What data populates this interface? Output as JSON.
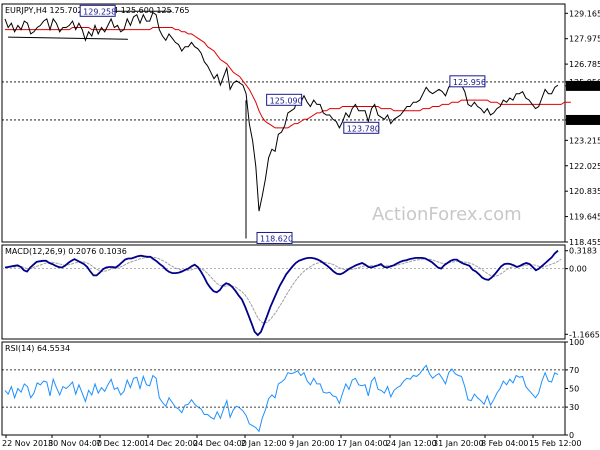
{
  "chart_data": [
    {
      "panel": "price",
      "type": "line",
      "header": "EURJPY,H4  125.702 125.904 125.600 125.765",
      "y_ticks": [
        "129.165",
        "127.975",
        "126.785",
        "125.950",
        "125.765",
        "124.170",
        "123.215",
        "122.025",
        "120.835",
        "119.645",
        "118.455"
      ],
      "ylim": [
        118.455,
        129.6
      ],
      "x_ticks": [
        "22 Nov 2018",
        "30 Nov 04:00",
        "7 Dec 12:00",
        "14 Dec 20:00",
        "24 Dec 04:00",
        "2 Jan 12:00",
        "9 Jan 20:00",
        "17 Jan 04:00",
        "24 Jan 12:00",
        "31 Jan 20:00",
        "8 Feb 04:00",
        "15 Feb 12:00"
      ],
      "series": [
        {
          "values": [
            128.9,
            128.5,
            128.7,
            128.3,
            128.6,
            128.4,
            128.8,
            128.7,
            128.2,
            128.3,
            128.5,
            128.6,
            128.8,
            128.9,
            128.4,
            128.9,
            128.7,
            128.3,
            128.5,
            128.5,
            128.6,
            128.8,
            128.4,
            128.7,
            128.4,
            127.9,
            128.3,
            128.1,
            128.6,
            128.2,
            128.5,
            128.3,
            128.6,
            128.9,
            128.5,
            128.6,
            128.3,
            128.4,
            128.9,
            128.6,
            129.0,
            129.1,
            128.7,
            129.1,
            128.8,
            128.8,
            129.2,
            129.1,
            128.4,
            128.1,
            127.9,
            128.2,
            128.0,
            127.8,
            127.7,
            127.4,
            127.6,
            127.6,
            127.8,
            127.6,
            127.5,
            127.3,
            126.9,
            126.7,
            126.4,
            126.1,
            126.3,
            125.8,
            126.2,
            126.6,
            125.6,
            125.9,
            126.0,
            125.9,
            125.8,
            125.4,
            124.0,
            123.2,
            122.0,
            119.9,
            120.6,
            121.4,
            122.4,
            122.8,
            122.7,
            123.5,
            123.6,
            123.9,
            124.5,
            124.6,
            124.7,
            125.1,
            125.0,
            125.3,
            125.0,
            124.8,
            125.1,
            124.9,
            124.9,
            124.5,
            124.4,
            124.4,
            124.2,
            124.1,
            123.8,
            124.1,
            124.5,
            124.3,
            124.7,
            124.9,
            124.6,
            124.6,
            124.6,
            124.1,
            124.7,
            124.9,
            124.4,
            124.3,
            124.2,
            124.4,
            124.0,
            124.2,
            124.3,
            124.4,
            124.6,
            124.8,
            124.8,
            125.0,
            125.0,
            125.1,
            125.4,
            125.7,
            125.5,
            125.4,
            125.5,
            125.6,
            125.5,
            125.3,
            125.7,
            125.9,
            125.8,
            125.8,
            125.8,
            125.5,
            124.9,
            124.8,
            125.0,
            124.8,
            124.7,
            124.5,
            124.7,
            124.4,
            124.5,
            124.7,
            124.8,
            125.1,
            125.0,
            125.2,
            125.1,
            125.4,
            125.4,
            125.5,
            125.2,
            125.1,
            124.9,
            124.7,
            124.8,
            125.2,
            125.6,
            125.4,
            125.4,
            125.7,
            125.8
          ],
          "color": "#000000"
        },
        {
          "values": [
            128.4,
            128.4,
            128.4,
            128.4,
            128.4,
            128.4,
            128.4,
            128.4,
            128.4,
            128.4,
            128.4,
            128.4,
            128.4,
            128.4,
            128.4,
            128.4,
            128.4,
            128.4,
            128.4,
            128.4,
            128.4,
            128.5,
            128.5,
            128.5,
            128.5,
            128.5,
            128.5,
            128.4,
            128.4,
            128.4,
            128.4,
            128.4,
            128.4,
            128.4,
            128.4,
            128.4,
            128.4,
            128.4,
            128.4,
            128.4,
            128.4,
            128.4,
            128.4,
            128.4,
            128.4,
            128.4,
            128.5,
            128.5,
            128.5,
            128.5,
            128.5,
            128.5,
            128.5,
            128.4,
            128.4,
            128.3,
            128.3,
            128.2,
            128.2,
            128.1,
            128.0,
            127.9,
            127.8,
            127.6,
            127.5,
            127.4,
            127.2,
            127.0,
            126.9,
            126.8,
            126.6,
            126.4,
            126.3,
            126.2,
            126.0,
            125.8,
            125.6,
            125.3,
            125.0,
            124.6,
            124.3,
            124.1,
            124.0,
            123.9,
            123.8,
            123.8,
            123.8,
            123.8,
            123.8,
            123.9,
            124.0,
            124.0,
            124.1,
            124.2,
            124.2,
            124.3,
            124.4,
            124.5,
            124.5,
            124.6,
            124.6,
            124.7,
            124.7,
            124.7,
            124.7,
            124.8,
            124.8,
            124.8,
            124.8,
            124.8,
            124.8,
            124.8,
            124.8,
            124.8,
            124.8,
            124.8,
            124.8,
            124.7,
            124.7,
            124.7,
            124.7,
            124.6,
            124.6,
            124.6,
            124.6,
            124.6,
            124.6,
            124.6,
            124.6,
            124.6,
            124.7,
            124.7,
            124.7,
            124.8,
            124.8,
            124.8,
            124.9,
            124.9,
            124.9,
            125.0,
            125.0,
            125.0,
            125.1,
            125.1,
            125.1,
            125.1,
            125.1,
            125.1,
            125.1,
            125.1,
            125.1,
            125.0,
            125.0,
            125.0,
            124.9,
            124.9,
            124.9,
            124.9,
            124.9,
            124.9,
            124.9,
            124.9,
            124.9,
            124.9,
            124.9,
            124.9,
            124.9,
            124.9,
            124.9,
            124.9,
            124.9,
            124.9,
            124.9,
            124.9,
            125.0,
            125.0,
            125.0
          ],
          "color": "#e00000"
        }
      ],
      "annotations": [
        {
          "text": "129.258",
          "x_index": 24,
          "y": 129.258
        },
        {
          "text": "125.090",
          "x_index": 82,
          "y": 125.09
        },
        {
          "text": "118.620",
          "x_index": 79,
          "y": 118.62
        },
        {
          "text": "123.780",
          "x_index": 106,
          "y": 123.78
        },
        {
          "text": "125.956",
          "x_index": 139,
          "y": 125.956
        }
      ],
      "levels": [
        125.95,
        124.17
      ],
      "price_marker": 125.765,
      "watermark": "ActionForex.com"
    },
    {
      "panel": "macd",
      "type": "line",
      "header": "MACD(12,26,9) 0.2076 0.1036",
      "y_ticks": [
        "0.3183",
        "0.00",
        "-1.1665"
      ],
      "ylim": [
        -1.25,
        0.42
      ],
      "series": [
        {
          "values": [
            0.02,
            0.03,
            0.04,
            0.05,
            0.06,
            0.03,
            -0.03,
            -0.05,
            0.02,
            0.07,
            0.12,
            0.13,
            0.14,
            0.14,
            0.1,
            0.08,
            0.05,
            0.03,
            0.02,
            0.05,
            0.1,
            0.14,
            0.17,
            0.14,
            0.11,
            0.08,
            0.03,
            -0.05,
            -0.12,
            -0.12,
            -0.07,
            -0.01,
            0.02,
            0.03,
            0.03,
            0.02,
            0.06,
            0.11,
            0.16,
            0.18,
            0.18,
            0.2,
            0.22,
            0.23,
            0.22,
            0.21,
            0.21,
            0.17,
            0.13,
            0.08,
            0.04,
            -0.02,
            -0.06,
            -0.08,
            -0.08,
            -0.07,
            -0.05,
            -0.02,
            0.0,
            0.04,
            0.07,
            0.03,
            -0.05,
            -0.15,
            -0.26,
            -0.34,
            -0.4,
            -0.42,
            -0.38,
            -0.3,
            -0.26,
            -0.28,
            -0.33,
            -0.4,
            -0.48,
            -0.55,
            -0.68,
            -0.82,
            -0.97,
            -1.12,
            -1.18,
            -1.12,
            -0.98,
            -0.83,
            -0.68,
            -0.55,
            -0.42,
            -0.3,
            -0.2,
            -0.1,
            -0.03,
            0.04,
            0.1,
            0.14,
            0.16,
            0.18,
            0.19,
            0.19,
            0.18,
            0.16,
            0.13,
            0.09,
            0.05,
            0.0,
            -0.05,
            -0.09,
            -0.1,
            -0.08,
            -0.04,
            0.0,
            0.03,
            0.06,
            0.08,
            0.1,
            0.07,
            0.03,
            0.02,
            0.04,
            0.06,
            0.08,
            0.03,
            0.02,
            0.04,
            0.06,
            0.09,
            0.12,
            0.14,
            0.15,
            0.17,
            0.18,
            0.19,
            0.19,
            0.19,
            0.18,
            0.15,
            0.12,
            0.07,
            0.02,
            0.0,
            0.06,
            0.1,
            0.14,
            0.16,
            0.16,
            0.12,
            0.09,
            0.07,
            0.05,
            -0.02,
            -0.05,
            -0.1,
            -0.16,
            -0.19,
            -0.2,
            -0.16,
            -0.1,
            -0.03,
            0.04,
            0.08,
            0.09,
            0.08,
            0.06,
            0.03,
            0.05,
            0.08,
            0.1,
            0.08,
            0.03,
            -0.03,
            0.0,
            0.05,
            0.1,
            0.15,
            0.2,
            0.27,
            0.32
          ],
          "color": "#00008b"
        },
        {
          "values": [
            0.02,
            0.02,
            0.03,
            0.03,
            0.04,
            0.04,
            0.02,
            0.0,
            0.0,
            0.02,
            0.04,
            0.06,
            0.08,
            0.1,
            0.11,
            0.11,
            0.1,
            0.09,
            0.07,
            0.06,
            0.07,
            0.08,
            0.1,
            0.11,
            0.12,
            0.12,
            0.1,
            0.07,
            0.03,
            -0.01,
            -0.04,
            -0.05,
            -0.04,
            -0.02,
            0.0,
            0.01,
            0.02,
            0.04,
            0.07,
            0.1,
            0.12,
            0.14,
            0.16,
            0.18,
            0.19,
            0.2,
            0.21,
            0.2,
            0.19,
            0.17,
            0.14,
            0.11,
            0.07,
            0.04,
            0.01,
            -0.01,
            -0.03,
            -0.04,
            -0.03,
            -0.02,
            0.0,
            0.01,
            0.0,
            -0.03,
            -0.08,
            -0.14,
            -0.2,
            -0.26,
            -0.3,
            -0.31,
            -0.31,
            -0.3,
            -0.31,
            -0.33,
            -0.37,
            -0.41,
            -0.47,
            -0.55,
            -0.65,
            -0.76,
            -0.87,
            -0.94,
            -0.97,
            -0.95,
            -0.9,
            -0.83,
            -0.75,
            -0.66,
            -0.57,
            -0.47,
            -0.38,
            -0.29,
            -0.21,
            -0.14,
            -0.08,
            -0.03,
            0.01,
            0.05,
            0.08,
            0.1,
            0.11,
            0.11,
            0.1,
            0.09,
            0.07,
            0.04,
            0.01,
            -0.01,
            -0.02,
            -0.02,
            -0.01,
            0.0,
            0.02,
            0.04,
            0.05,
            0.05,
            0.05,
            0.05,
            0.05,
            0.06,
            0.05,
            0.05,
            0.05,
            0.05,
            0.06,
            0.08,
            0.09,
            0.11,
            0.12,
            0.14,
            0.15,
            0.16,
            0.17,
            0.17,
            0.17,
            0.16,
            0.14,
            0.12,
            0.1,
            0.09,
            0.1,
            0.11,
            0.12,
            0.13,
            0.13,
            0.12,
            0.11,
            0.1,
            0.08,
            0.05,
            0.02,
            -0.02,
            -0.06,
            -0.1,
            -0.13,
            -0.14,
            -0.12,
            -0.09,
            -0.05,
            -0.01,
            0.02,
            0.04,
            0.04,
            0.04,
            0.05,
            0.06,
            0.07,
            0.07,
            0.06,
            0.04,
            0.03,
            0.04,
            0.06,
            0.08,
            0.1,
            0.13,
            0.17
          ],
          "color": "#a0a0a0"
        }
      ]
    },
    {
      "panel": "rsi",
      "type": "line",
      "header": "RSI(14) 64.5534",
      "y_ticks": [
        "100",
        "70",
        "50",
        "30",
        "0"
      ],
      "ylim": [
        0,
        100
      ],
      "levels": [
        70,
        30
      ],
      "series": [
        {
          "values": [
            48,
            44,
            52,
            40,
            50,
            46,
            55,
            52,
            40,
            45,
            56,
            54,
            58,
            57,
            42,
            60,
            51,
            43,
            52,
            50,
            53,
            57,
            44,
            54,
            45,
            36,
            48,
            43,
            55,
            45,
            51,
            47,
            54,
            60,
            49,
            51,
            43,
            47,
            59,
            51,
            61,
            62,
            50,
            63,
            54,
            53,
            64,
            61,
            40,
            35,
            31,
            40,
            35,
            30,
            28,
            24,
            32,
            33,
            38,
            33,
            30,
            28,
            22,
            22,
            19,
            17,
            25,
            18,
            28,
            37,
            19,
            27,
            31,
            29,
            26,
            21,
            12,
            10,
            8,
            4,
            18,
            27,
            39,
            43,
            40,
            55,
            57,
            60,
            67,
            66,
            67,
            69,
            64,
            67,
            58,
            54,
            61,
            55,
            55,
            46,
            45,
            46,
            42,
            41,
            34,
            45,
            55,
            49,
            59,
            61,
            54,
            53,
            54,
            42,
            58,
            62,
            49,
            48,
            45,
            52,
            41,
            48,
            51,
            53,
            58,
            61,
            60,
            64,
            63,
            66,
            71,
            75,
            66,
            61,
            64,
            66,
            61,
            55,
            67,
            71,
            66,
            64,
            63,
            52,
            38,
            37,
            44,
            40,
            37,
            33,
            42,
            32,
            38,
            45,
            50,
            58,
            54,
            60,
            56,
            64,
            62,
            63,
            52,
            48,
            44,
            40,
            45,
            58,
            67,
            58,
            57,
            67,
            65
          ],
          "color": "#1e90ff"
        }
      ],
      "x_ticks": [
        "22 Nov 2018",
        "30 Nov 04:00",
        "7 Dec 12:00",
        "14 Dec 20:00",
        "24 Dec 04:00",
        "2 Jan 12:00",
        "9 Jan 20:00",
        "17 Jan 04:00",
        "24 Jan 12:00",
        "31 Jan 20:00",
        "8 Feb 04:00",
        "15 Feb 12:00"
      ]
    }
  ]
}
